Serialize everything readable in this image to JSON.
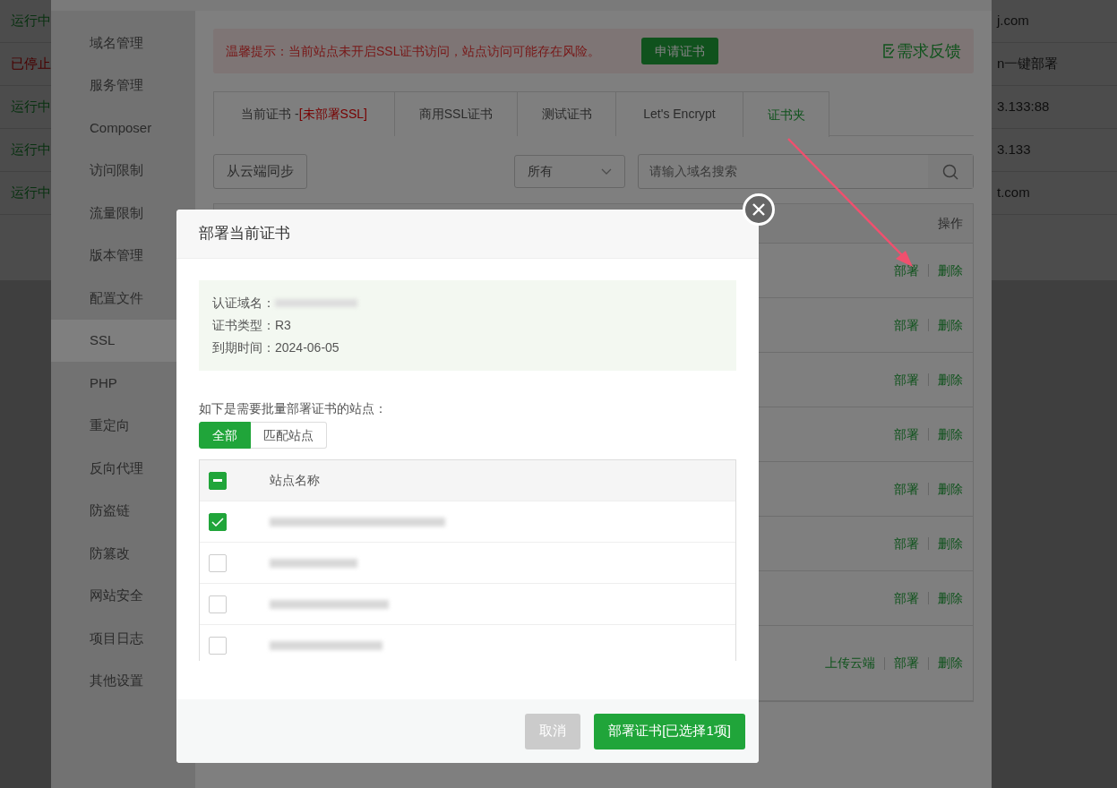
{
  "background_page": {
    "rows": [
      {
        "status": "运行中",
        "kind": "running",
        "column_end": "j.com"
      },
      {
        "status": "已停止",
        "kind": "stopped",
        "column_end": "n一键部署"
      },
      {
        "status": "运行中",
        "kind": "running",
        "column_end": "3.133:88"
      },
      {
        "status": "运行中",
        "kind": "running",
        "column_end": "3.133"
      },
      {
        "status": "运行中",
        "kind": "running",
        "column_end": "t.com"
      }
    ]
  },
  "panel": {
    "sidebar": {
      "items": [
        {
          "label": "域名管理",
          "selected": false
        },
        {
          "label": "服务管理",
          "selected": false
        },
        {
          "label": "Composer",
          "selected": false
        },
        {
          "label": "访问限制",
          "selected": false
        },
        {
          "label": "流量限制",
          "selected": false
        },
        {
          "label": "版本管理",
          "selected": false
        },
        {
          "label": "配置文件",
          "selected": false
        },
        {
          "label": "SSL",
          "selected": true
        },
        {
          "label": "PHP",
          "selected": false
        },
        {
          "label": "重定向",
          "selected": false
        },
        {
          "label": "反向代理",
          "selected": false
        },
        {
          "label": "防盗链",
          "selected": false
        },
        {
          "label": "防篡改",
          "selected": false
        },
        {
          "label": "网站安全",
          "selected": false
        },
        {
          "label": "项目日志",
          "selected": false
        },
        {
          "label": "其他设置",
          "selected": false
        }
      ]
    },
    "alert": {
      "text": "温馨提示：当前站点未开启SSL证书访问，站点访问可能存在风险。",
      "button": "申请证书",
      "feedback": "需求反馈"
    },
    "tabs": [
      {
        "label": "当前证书 -",
        "note": "[未部署SSL]",
        "selected": false
      },
      {
        "label": "商用SSL证书",
        "selected": false
      },
      {
        "label": "测试证书",
        "selected": false
      },
      {
        "label": "Let's Encrypt",
        "selected": false
      },
      {
        "label": "证书夹",
        "selected": true
      }
    ],
    "sync_button": "从云端同步",
    "filter": {
      "value": "所有"
    },
    "search": {
      "placeholder": "请输入域名搜索"
    },
    "table": {
      "columns": [
        "操作"
      ],
      "rows": [
        {
          "actions": [
            "部署",
            "删除"
          ]
        },
        {
          "actions": [
            "部署",
            "删除"
          ]
        },
        {
          "actions": [
            "部署",
            "删除"
          ]
        },
        {
          "actions": [
            "部署",
            "删除"
          ]
        },
        {
          "actions": [
            "部署",
            "删除"
          ]
        },
        {
          "actions": [
            "部署",
            "删除"
          ]
        },
        {
          "actions": [
            "部署",
            "删除"
          ]
        },
        {
          "actions": [
            "上传云端",
            "部署",
            "删除"
          ]
        }
      ]
    }
  },
  "modal": {
    "title": "部署当前证书",
    "info": [
      {
        "label": "认证域名：",
        "redacted": true
      },
      {
        "label": "证书类型：",
        "value": "R3"
      },
      {
        "label": "到期时间：",
        "value": "2024-06-05"
      }
    ],
    "prompt": "如下是需要批量部署证书的站点：",
    "segments": [
      {
        "label": "全部",
        "selected": true
      },
      {
        "label": "匹配站点",
        "selected": false
      }
    ],
    "sites": {
      "select_all": {
        "checked": true,
        "indeterminate": true
      },
      "column": "站点名称",
      "rows": [
        {
          "checked": true
        },
        {
          "checked": false
        },
        {
          "checked": false
        },
        {
          "checked": false
        }
      ]
    },
    "buttons": [
      {
        "label": "取消",
        "kind": "cancel"
      },
      {
        "label": "部署证书[已选择1项]",
        "kind": "primary"
      }
    ]
  }
}
